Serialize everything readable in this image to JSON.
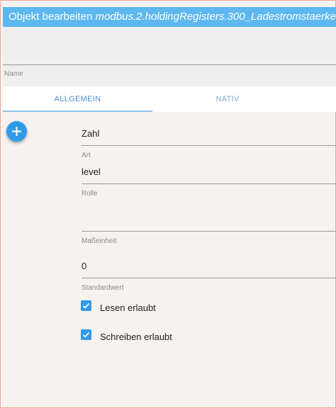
{
  "dialog": {
    "title_prefix": "Objekt bearbeiten ",
    "object_id": "modbus.2.holdingRegisters.300_Ladestromstaerke"
  },
  "name_field": {
    "label": "Name",
    "value": ""
  },
  "tabs": [
    {
      "label": "ALLGEMEIN",
      "active": true
    },
    {
      "label": "NATIV",
      "active": false
    }
  ],
  "add_button": {
    "icon": "plus-icon"
  },
  "fields": {
    "typ": {
      "value": "Zahl",
      "label": "Art"
    },
    "rolle": {
      "value": "level",
      "label": "Rolle"
    },
    "einheit": {
      "value": "",
      "label": "Maßeinheit"
    },
    "standard": {
      "value": "0",
      "label": "Standardwert"
    }
  },
  "checkboxes": [
    {
      "label": "Lesen erlaubt",
      "checked": true
    },
    {
      "label": "Schreiben erlaubt",
      "checked": true
    }
  ],
  "colors": {
    "titlebar": "#5eb8f0",
    "accent": "#2f9be8",
    "background": "#f6f2ef"
  }
}
